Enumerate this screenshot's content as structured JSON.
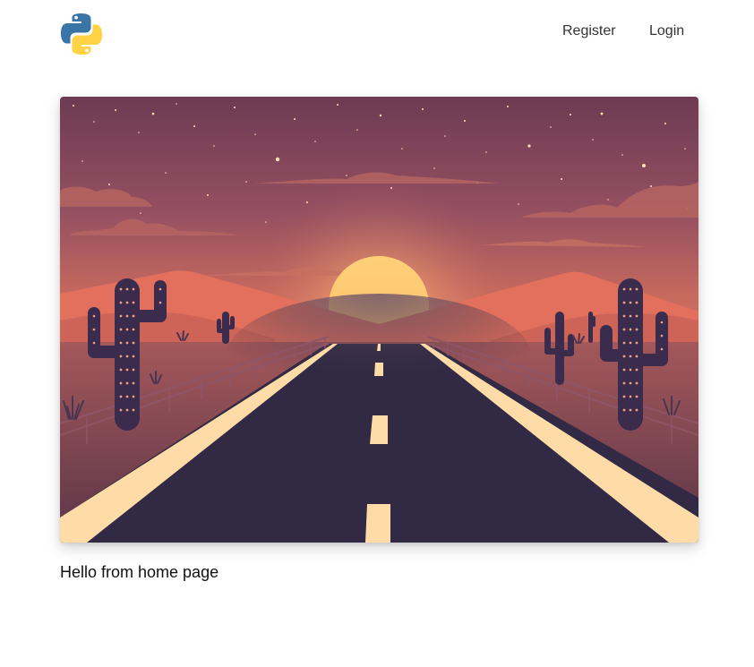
{
  "navbar": {
    "logo_icon": "python-logo-icon",
    "links": [
      {
        "label": "Register"
      },
      {
        "label": "Login"
      }
    ]
  },
  "hero": {
    "scene": "desert-highway-sunset-illustration"
  },
  "main": {
    "greeting": "Hello from home page"
  },
  "colors": {
    "python_blue": "#3a75a8",
    "python_yellow": "#ffd343",
    "sky_top": "#6e3b53",
    "sky_bottom": "#c5685e",
    "road": "#322a44",
    "road_line": "#ffdca7"
  }
}
